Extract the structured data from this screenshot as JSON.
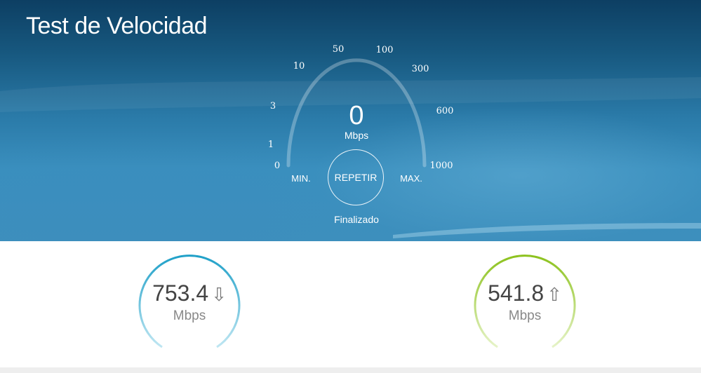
{
  "header": {
    "title": "Test de Velocidad"
  },
  "gauge": {
    "value": "0",
    "unit": "Mbps",
    "scale_labels": [
      "0",
      "1",
      "3",
      "10",
      "50",
      "100",
      "300",
      "600",
      "1000"
    ],
    "min_label": "MIN.",
    "max_label": "MAX.",
    "repeat_label": "REPETIR",
    "status": "Finalizado"
  },
  "download": {
    "value": "753.4",
    "unit": "Mbps",
    "icon": "arrow-down-icon",
    "color": "#1fa0c8"
  },
  "upload": {
    "value": "541.8",
    "unit": "Mbps",
    "icon": "arrow-up-icon",
    "color": "#8cc21d"
  }
}
